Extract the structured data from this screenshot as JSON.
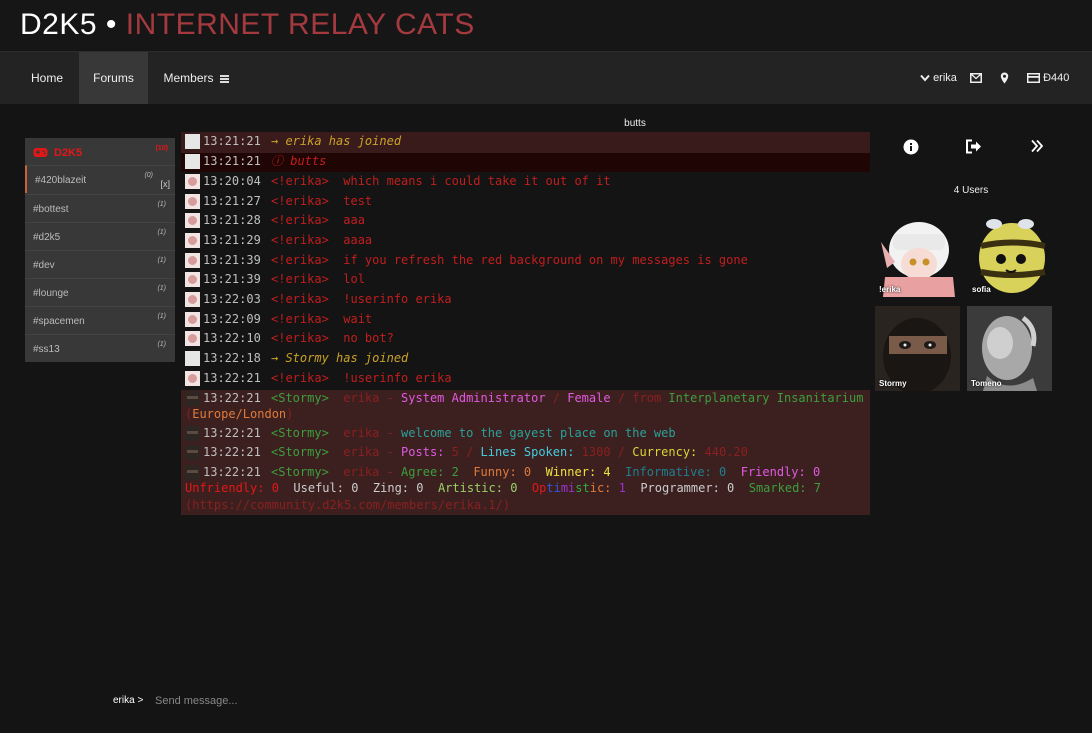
{
  "site": {
    "name": "D2K5",
    "separator": "•",
    "subtitle": "INTERNET RELAY CATS"
  },
  "nav": {
    "tabs": [
      {
        "label": "Home"
      },
      {
        "label": "Forums"
      },
      {
        "label": "Members"
      }
    ],
    "user": "erika",
    "balance": "Đ440",
    "icons": [
      "chevron-down-icon",
      "mail-icon",
      "map-pin-icon",
      "credit-card-icon",
      "hamburger-menu-icon"
    ]
  },
  "sidebar": {
    "network": {
      "name": "D2K5",
      "count": "(10)"
    },
    "channels": [
      {
        "name": "#420blazeit",
        "count": "(0)",
        "close": "[x]"
      },
      {
        "name": "#bottest",
        "count": "(1)"
      },
      {
        "name": "#d2k5",
        "count": "(1)"
      },
      {
        "name": "#dev",
        "count": "(1)"
      },
      {
        "name": "#lounge",
        "count": "(1)"
      },
      {
        "name": "#spacemen",
        "count": "(1)"
      },
      {
        "name": "#ss13",
        "count": "(1)"
      }
    ]
  },
  "channel": {
    "topic": "butts"
  },
  "chat": {
    "lines": [
      {
        "time": "13:21:21",
        "nick": "",
        "text": "→ erika has joined"
      },
      {
        "time": "13:21:21",
        "nick": "",
        "text": "ⓘ butts"
      },
      {
        "time": "13:20:04",
        "nick": "<!erika>",
        "text": "which means i could take it out of it"
      },
      {
        "time": "13:21:27",
        "nick": "<!erika>",
        "text": "test"
      },
      {
        "time": "13:21:28",
        "nick": "<!erika>",
        "text": "aaa"
      },
      {
        "time": "13:21:29",
        "nick": "<!erika>",
        "text": "aaaa"
      },
      {
        "time": "13:21:39",
        "nick": "<!erika>",
        "text": "if you refresh the red background on my messages is gone"
      },
      {
        "time": "13:21:39",
        "nick": "<!erika>",
        "text": "lol"
      },
      {
        "time": "13:22:03",
        "nick": "<!erika>",
        "text": "!userinfo erika"
      },
      {
        "time": "13:22:09",
        "nick": "<!erika>",
        "text": "wait"
      },
      {
        "time": "13:22:10",
        "nick": "<!erika>",
        "text": "no bot?"
      },
      {
        "time": "13:22:18",
        "nick": "",
        "text": "→ Stormy has joined"
      },
      {
        "time": "13:22:21",
        "nick": "<!erika>",
        "text": "!userinfo erika"
      },
      {
        "time": "13:22:21",
        "nick": "<Stormy>",
        "text": "erika - System Administrator / Female / from Interplanetary Insanitarium"
      },
      {
        "time": "",
        "nick": "",
        "text": "(Europe/London)"
      },
      {
        "time": "13:22:21",
        "nick": "<Stormy>",
        "text": "erika - welcome to the gayest place on the web"
      },
      {
        "time": "13:22:21",
        "nick": "<Stormy>",
        "text": "erika - Posts: 5 / Lines Spoken: 1300 / Currency: 440.20"
      },
      {
        "time": "13:22:21",
        "nick": "<Stormy>",
        "text": "erika - Agree: 2  Funny: 0  Winner: 4  Informative: 0  Friendly: 0"
      },
      {
        "time": "",
        "nick": "",
        "text": "Unfriendly: 0  Useful: 0  Zing: 0  Artistic: 0  Optimistic: 1  Programmer: 0  Smarked: 7"
      },
      {
        "time": "",
        "nick": "",
        "text": "(https://community.d2k5.com/members/erika.1/)"
      }
    ]
  },
  "users": {
    "count_label": "4 Users",
    "list": [
      {
        "name": "!erika"
      },
      {
        "name": "sofia"
      },
      {
        "name": "Stormy"
      },
      {
        "name": "Tomeno"
      }
    ],
    "icons": [
      "info-icon",
      "sign-out-icon",
      "double-chevron-right-icon"
    ]
  },
  "input": {
    "prompt": "erika >",
    "placeholder": "Send message..."
  },
  "colors": {
    "accent": "#a43a3f",
    "network_red": "#e21818",
    "message_red": "#c21e1e",
    "join_yellow": "#c9a227",
    "nick_green": "#3d9e3d",
    "highlight_bg": "#3c1a1a"
  }
}
